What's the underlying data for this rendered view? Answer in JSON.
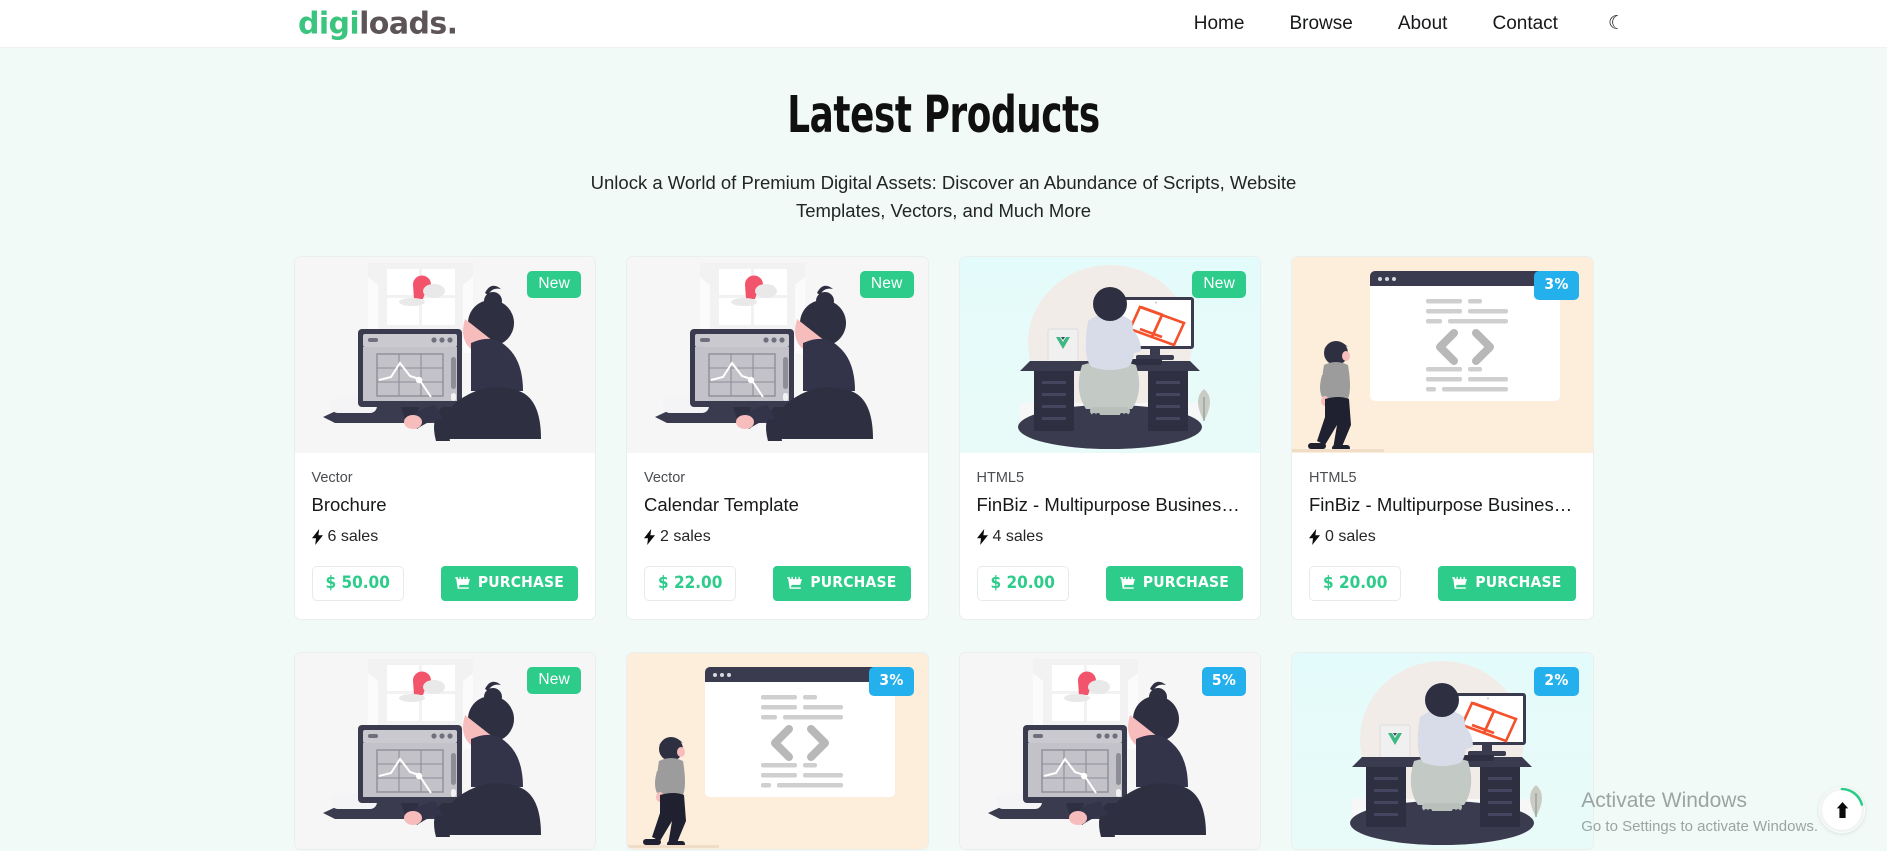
{
  "header": {
    "brand_first": "digi",
    "brand_second": "loads.",
    "nav": [
      {
        "label": "Home",
        "name": "home"
      },
      {
        "label": "Browse",
        "name": "browse"
      },
      {
        "label": "About",
        "name": "about"
      },
      {
        "label": "Contact",
        "name": "contact"
      }
    ],
    "theme_toggle_icon": "moon-icon",
    "theme_toggle_glyph": "☾"
  },
  "page": {
    "title": "Latest Products",
    "subtitle": "Unlock a World of Premium Digital Assets: Discover an Abundance of Scripts, Website Templates, Vectors, and Much More"
  },
  "products": [
    {
      "category": "Vector",
      "title": "Brochure",
      "sales": "6 sales",
      "price": "$ 50.00",
      "purchase_label": "PURCHASE",
      "badge": "New",
      "badge_type": "new",
      "illustration": "designer-at-monitor",
      "media_bg": "gray"
    },
    {
      "category": "Vector",
      "title": "Calendar Template",
      "sales": "2 sales",
      "price": "$ 22.00",
      "purchase_label": "PURCHASE",
      "badge": "New",
      "badge_type": "new",
      "illustration": "designer-at-monitor",
      "media_bg": "gray"
    },
    {
      "category": "HTML5",
      "title": "FinBiz - Multipurpose Business...",
      "sales": "4 sales",
      "price": "$ 20.00",
      "purchase_label": "PURCHASE",
      "badge": "New",
      "badge_type": "new",
      "illustration": "developer-at-desk",
      "media_bg": "teal"
    },
    {
      "category": "HTML5",
      "title": "FinBiz - Multipurpose Business...",
      "sales": "0 sales",
      "price": "$ 20.00",
      "purchase_label": "PURCHASE",
      "badge": "3%",
      "badge_type": "discount",
      "illustration": "code-window",
      "media_bg": "cream"
    }
  ],
  "products_row2": [
    {
      "badge": "New",
      "badge_type": "new",
      "illustration": "designer-at-monitor",
      "media_bg": "gray"
    },
    {
      "badge": "3%",
      "badge_type": "discount",
      "illustration": "code-window",
      "media_bg": "cream"
    },
    {
      "badge": "5%",
      "badge_type": "discount",
      "illustration": "designer-at-monitor",
      "media_bg": "gray"
    },
    {
      "badge": "2%",
      "badge_type": "discount",
      "illustration": "developer-at-desk",
      "media_bg": "teal"
    }
  ],
  "watermark": {
    "title": "Activate Windows",
    "subtitle": "Go to Settings to activate Windows."
  },
  "scroll_top": {
    "icon": "arrow-up-icon"
  },
  "colors": {
    "brand_green": "#2ecc8a",
    "brand_dark": "#5d5457",
    "badge_blue": "#23b0ec",
    "page_bg": "#f1faf6",
    "card_bg": "#ffffff",
    "text_dark": "#16181a"
  }
}
